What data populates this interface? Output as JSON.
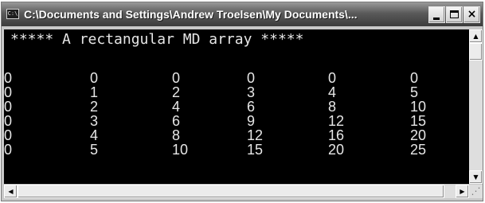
{
  "window": {
    "title": "C:\\Documents and Settings\\Andrew Troelsen\\My Documents\\...",
    "icon": "console-app-icon",
    "icon_glyph": "C:\\",
    "buttons": {
      "minimize": "minimize-icon",
      "maximize": "maximize-icon",
      "close": "×"
    }
  },
  "console": {
    "header": "***** A rectangular MD array *****",
    "rows": [
      [
        "0",
        "0",
        "0",
        "0",
        "0",
        "0"
      ],
      [
        "0",
        "1",
        "2",
        "3",
        "4",
        "5"
      ],
      [
        "0",
        "2",
        "4",
        "6",
        "8",
        "10"
      ],
      [
        "0",
        "3",
        "6",
        "9",
        "12",
        "15"
      ],
      [
        "0",
        "4",
        "8",
        "12",
        "16",
        "20"
      ],
      [
        "0",
        "5",
        "10",
        "15",
        "20",
        "25"
      ]
    ]
  },
  "scrollbars": {
    "up": "▲",
    "down": "▼",
    "left": "◀",
    "right": "▶",
    "grip": "⋰"
  }
}
